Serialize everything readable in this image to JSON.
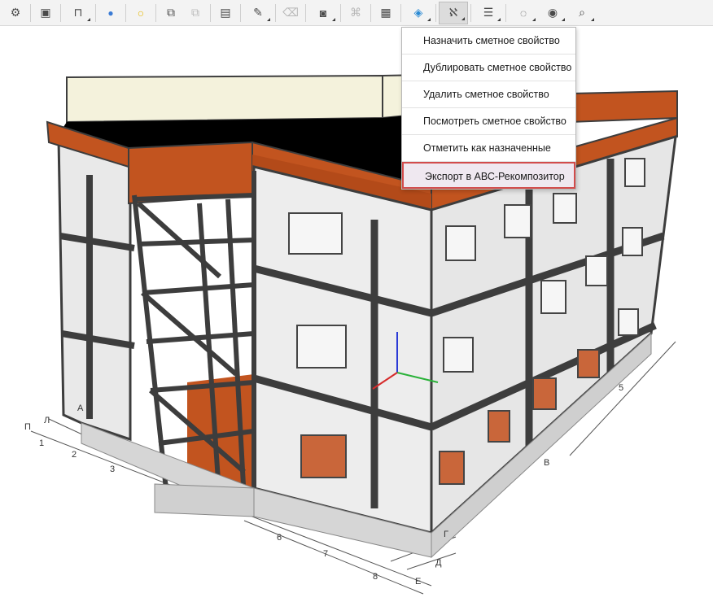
{
  "toolbar": {
    "buttons": [
      {
        "icon": "gear-icon",
        "glyph": "⚙"
      },
      {
        "icon": "fit-frame-icon",
        "glyph": "▣"
      },
      {
        "icon": "section-view-icon",
        "glyph": "⊓"
      },
      {
        "icon": "blue-dot-icon",
        "glyph": "●",
        "color": "#3a7bd5"
      },
      {
        "icon": "yellow-dot-icon",
        "glyph": "○",
        "color": "#e6b800"
      },
      {
        "icon": "select-object-icon",
        "glyph": "⧉"
      },
      {
        "icon": "deselect-object-icon",
        "glyph": "⧉"
      },
      {
        "icon": "calc-icon",
        "glyph": "▤"
      },
      {
        "icon": "measure-ruler-icon",
        "glyph": "✎"
      },
      {
        "icon": "trash-icon",
        "glyph": "🗑"
      },
      {
        "icon": "camera-icon",
        "glyph": "◙"
      },
      {
        "icon": "clip-icon",
        "glyph": "⌘"
      },
      {
        "icon": "report-icon",
        "glyph": "▦"
      },
      {
        "icon": "export-model-icon",
        "glyph": "◈"
      },
      {
        "icon": "estimate-property-icon",
        "glyph": "ℵ"
      },
      {
        "icon": "list-icon",
        "glyph": "☰"
      },
      {
        "icon": "hide-icon",
        "glyph": "◌"
      },
      {
        "icon": "eye-icon",
        "glyph": "◉"
      },
      {
        "icon": "zoom-icon",
        "glyph": "⌕"
      }
    ]
  },
  "menu": {
    "items": [
      "Назначить сметное свойство",
      "Дублировать сметное свойство",
      "Удалить сметное свойство",
      "Посмотреть сметное свойство",
      "Отметить как назначенные",
      "Экспорт в АВС-Рекомпозитор"
    ],
    "highlighted_index": 5,
    "highlight_border_color": "#d24c4c"
  },
  "grid_axes": {
    "numbers": [
      "1",
      "2",
      "3",
      "5",
      "6",
      "7",
      "8"
    ],
    "letters": [
      "П",
      "Л",
      "В",
      "Г",
      "Д",
      "Е",
      "А"
    ]
  },
  "colors": {
    "parapet": "#c2541f",
    "wall_panel": "#e9e9e9",
    "frame": "#3d3d3d",
    "roof": "#000000",
    "foundation": "#d6d6d6",
    "toolbar_bg": "#f3f3f3"
  }
}
